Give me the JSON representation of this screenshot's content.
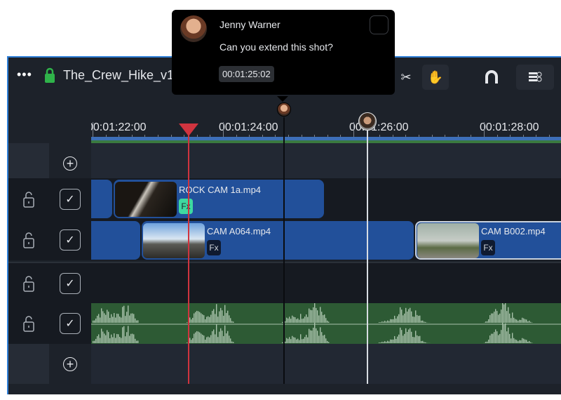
{
  "header": {
    "project_title": "The_Crew_Hike_v1",
    "more_icon": "more-icon",
    "lock_icon": "lock-icon",
    "tools": [
      "scissors-icon",
      "hand-icon",
      "magnet-icon",
      "track-settings-icon"
    ]
  },
  "comment": {
    "author": "Jenny Warner",
    "text": "Can you extend this shot?",
    "timecode": "00:01:25:02"
  },
  "ruler": {
    "labels": [
      "00:01:22:00",
      "00:01:24:00",
      "00:01:26:00",
      "00:01:28:00"
    ]
  },
  "tracks": {
    "video1": {
      "clip_name": "ROCK CAM 1a.mp4",
      "fx": "Fx"
    },
    "video2": {
      "clips": [
        {
          "name": "CAM A064.mp4",
          "fx": "Fx"
        },
        {
          "name": "CAM B002.mp4",
          "fx": "Fx"
        }
      ]
    }
  },
  "colors": {
    "accent": "#2f7fd6",
    "clip": "#22509a",
    "audio": "#2d5a34",
    "playhead": "#d0343f",
    "fx_active": "#3fd9a0"
  }
}
